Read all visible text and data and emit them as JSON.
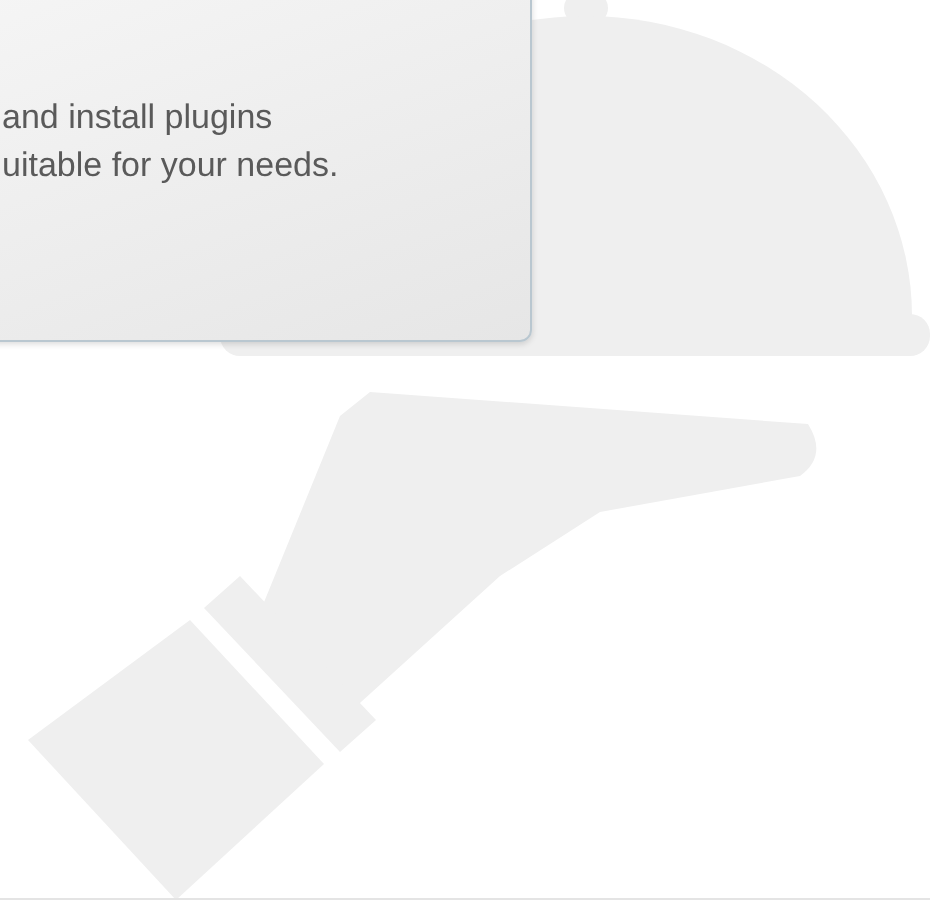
{
  "card": {
    "lines": [
      "and install plugins",
      "uitable for your needs."
    ]
  }
}
